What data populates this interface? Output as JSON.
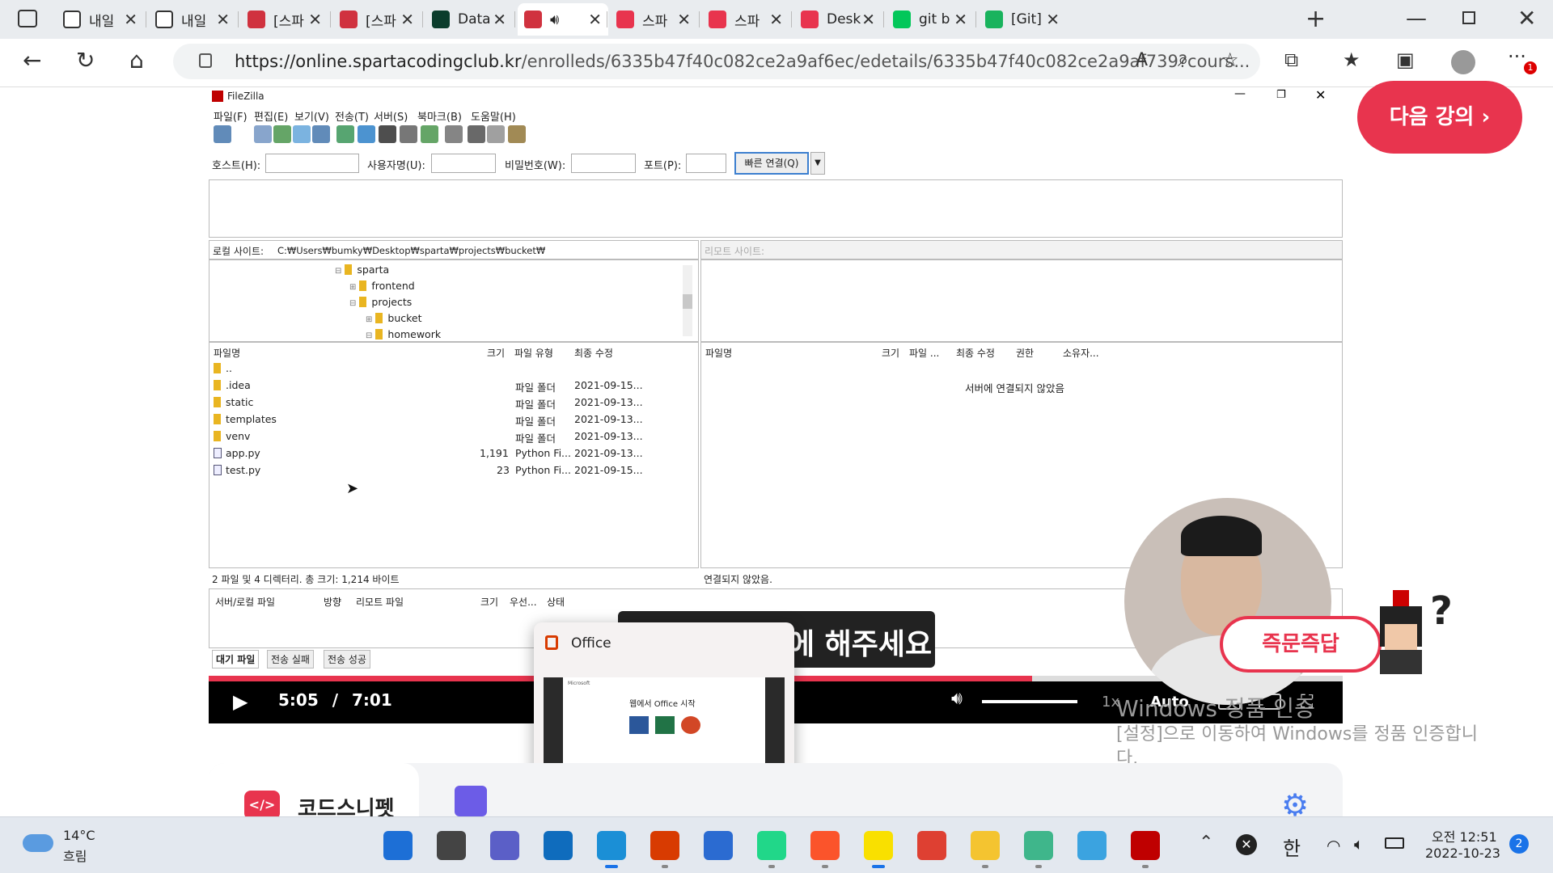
{
  "browser": {
    "tabs": [
      {
        "label": "내일",
        "color": "#ffffff"
      },
      {
        "label": "내일",
        "color": "#ffffff"
      },
      {
        "label": "[스파",
        "color": "#d0323f"
      },
      {
        "label": "[스파",
        "color": "#d0323f"
      },
      {
        "label": "Data",
        "color": "#0b3d2c"
      },
      {
        "label": "",
        "color": "#d0323f"
      },
      {
        "label": "스파",
        "color": "#e8344e"
      },
      {
        "label": "스파",
        "color": "#e8344e"
      },
      {
        "label": "Desk",
        "color": "#e8344e"
      },
      {
        "label": "git b",
        "color": "#03c75a"
      },
      {
        "label": "[Git]",
        "color": "#19b35d"
      }
    ],
    "url_host": "https://online.spartacodingclub.kr",
    "url_path": "/enrolleds/6335b47f40c082ce2a9af6ec/edetails/6335b47f40c082ce2a9af739?cours...",
    "notification_badge": "1"
  },
  "filezilla": {
    "title": "FileZilla",
    "menu": [
      "파일(F)",
      "편집(E)",
      "보기(V)",
      "전송(T)",
      "서버(S)",
      "북마크(B)",
      "도움말(H)"
    ],
    "quick": {
      "host": "호스트(H):",
      "user": "사용자명(U):",
      "pass": "비밀번호(W):",
      "port": "포트(P):",
      "connect": "빠른 연결(Q)"
    },
    "local_label": "로컬 사이트:",
    "local_path": "C:₩Users₩bumky₩Desktop₩sparta₩projects₩bucket₩",
    "remote_label": "리모트 사이트:",
    "tree": [
      "sparta",
      "frontend",
      "projects",
      "bucket",
      "homework"
    ],
    "local_cols": [
      "파일명",
      "크기",
      "파일 유형",
      "최종 수정"
    ],
    "local_files": [
      {
        "name": "..",
        "size": "",
        "type": "",
        "date": ""
      },
      {
        "name": ".idea",
        "size": "",
        "type": "파일 폴더",
        "date": "2021-09-15..."
      },
      {
        "name": "static",
        "size": "",
        "type": "파일 폴더",
        "date": "2021-09-13..."
      },
      {
        "name": "templates",
        "size": "",
        "type": "파일 폴더",
        "date": "2021-09-13..."
      },
      {
        "name": "venv",
        "size": "",
        "type": "파일 폴더",
        "date": "2021-09-13..."
      },
      {
        "name": "app.py",
        "size": "1,191",
        "type": "Python Fi...",
        "date": "2021-09-13..."
      },
      {
        "name": "test.py",
        "size": "23",
        "type": "Python Fi...",
        "date": "2021-09-15..."
      }
    ],
    "local_status": "2 파일 및 4 디렉터리. 총 크기: 1,214 바이트",
    "remote_cols": [
      "파일명",
      "크기",
      "파일 ...",
      "최종 수정",
      "권한",
      "소유자..."
    ],
    "remote_empty": "서버에 연결되지 않았음",
    "remote_status": "연결되지 않았음.",
    "queue_cols": [
      "서버/로컬 파일",
      "방향",
      "리모트 파일",
      "크기",
      "우선...",
      "상태"
    ],
    "queue_tabs": [
      "대기 파일",
      "전송 실패",
      "전송 성공"
    ]
  },
  "video": {
    "current": "5:05",
    "sep": "/",
    "total": "7:01",
    "speed": "1x",
    "quality": "Auto",
    "progress": 0.726,
    "subtitle": "에 해주세요"
  },
  "office_popup": {
    "title": "Office",
    "brand": "Microsoft",
    "heading": "웹에서 Office 시작"
  },
  "next_lecture": "다음 강의",
  "qna_badge": "즉문즉답",
  "windows_activation": {
    "line1": "Windows 정품 인증",
    "line2": "[설정]으로 이동하여 Windows를 정품 인증합니",
    "line3": "다."
  },
  "bottom": {
    "codesnippet": "코드스니펫"
  },
  "taskbar": {
    "weather_temp": "14°C",
    "weather_desc": "흐림",
    "ime": "한",
    "time": "오전 12:51",
    "date": "2022-10-23",
    "notifications": "2",
    "apps": [
      {
        "name": "start-icon",
        "color": "#1d6fd6"
      },
      {
        "name": "taskview-icon",
        "color": "#444444"
      },
      {
        "name": "teams-chat-icon",
        "color": "#5b5fc7"
      },
      {
        "name": "mail-icon",
        "color": "#0f6cbd"
      },
      {
        "name": "edge-icon",
        "color": "#1b8fd6"
      },
      {
        "name": "office-icon",
        "color": "#d83b01"
      },
      {
        "name": "store-icon",
        "color": "#2b6bd1"
      },
      {
        "name": "pycharm-icon",
        "color": "#21d789"
      },
      {
        "name": "brave-icon",
        "color": "#fb542b"
      },
      {
        "name": "kakaotalk-icon",
        "color": "#f9e000"
      },
      {
        "name": "chrome-icon",
        "color": "#de4032"
      },
      {
        "name": "file-explorer-icon",
        "color": "#f4c430"
      },
      {
        "name": "gitkraken-icon",
        "color": "#3fb68b"
      },
      {
        "name": "notepad-icon",
        "color": "#3ba3e0"
      },
      {
        "name": "filezilla-icon",
        "color": "#bf0000"
      }
    ]
  }
}
